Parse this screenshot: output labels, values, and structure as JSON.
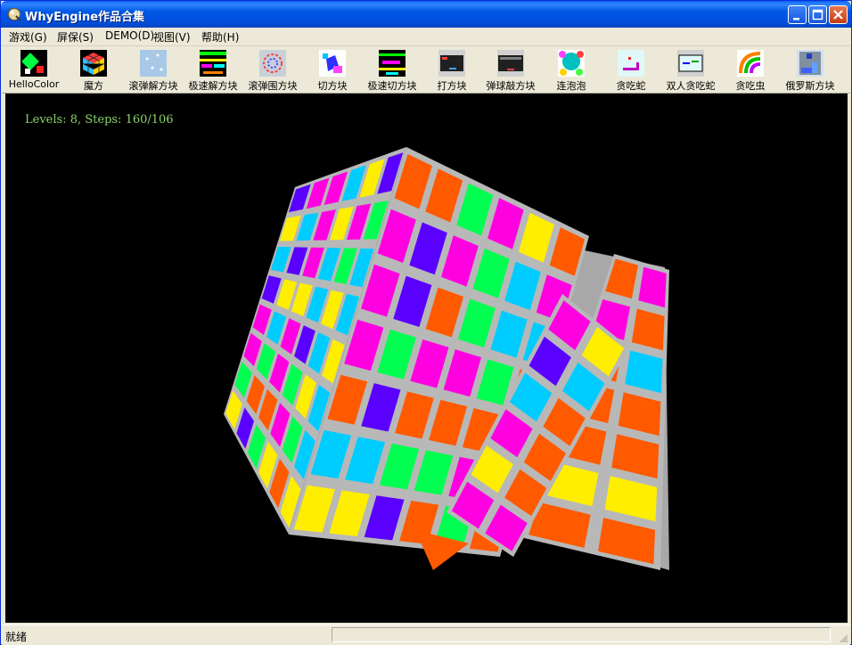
{
  "window": {
    "title": "WhyEngine作品合集",
    "title_bar_color": "#0058e6"
  },
  "menu": [
    {
      "label": "游戏(G)"
    },
    {
      "label": "屏保(S)"
    },
    {
      "label": "DEMO(D)"
    },
    {
      "label": "视图(V)"
    },
    {
      "label": "帮助(H)"
    }
  ],
  "toolbar": [
    {
      "label": "HelloColor",
      "icon": "hellocolor-icon"
    },
    {
      "label": "魔方",
      "icon": "rubiks-cube-icon"
    },
    {
      "label": "滚弹解方块",
      "icon": "bounce-break-icon"
    },
    {
      "label": "极速解方块",
      "icon": "speed-break-icon"
    },
    {
      "label": "滚弹围方块",
      "icon": "bounce-surround-icon"
    },
    {
      "label": "切方块",
      "icon": "cut-block-icon"
    },
    {
      "label": "极速切方块",
      "icon": "speed-cut-icon"
    },
    {
      "label": "打方块",
      "icon": "hit-block-icon"
    },
    {
      "label": "弹球敲方块",
      "icon": "pinball-block-icon"
    },
    {
      "label": "连泡泡",
      "icon": "bubble-icon"
    },
    {
      "label": "贪吃蛇",
      "icon": "snake-icon"
    },
    {
      "label": "双人贪吃蛇",
      "icon": "two-player-snake-icon"
    },
    {
      "label": "贪吃虫",
      "icon": "worm-icon"
    },
    {
      "label": "俄罗斯方块",
      "icon": "tetris-icon"
    }
  ],
  "game": {
    "hud_text": "Levels: 8, Steps: 160/106",
    "background": "#000000",
    "hud_color": "#8bd36a",
    "face_colors": [
      "#ff5a00",
      "#ff00e0",
      "#00ff50",
      "#00ccff",
      "#ffee00",
      "#5a00ff",
      "#cccccc"
    ]
  },
  "status": {
    "text": "就绪"
  }
}
